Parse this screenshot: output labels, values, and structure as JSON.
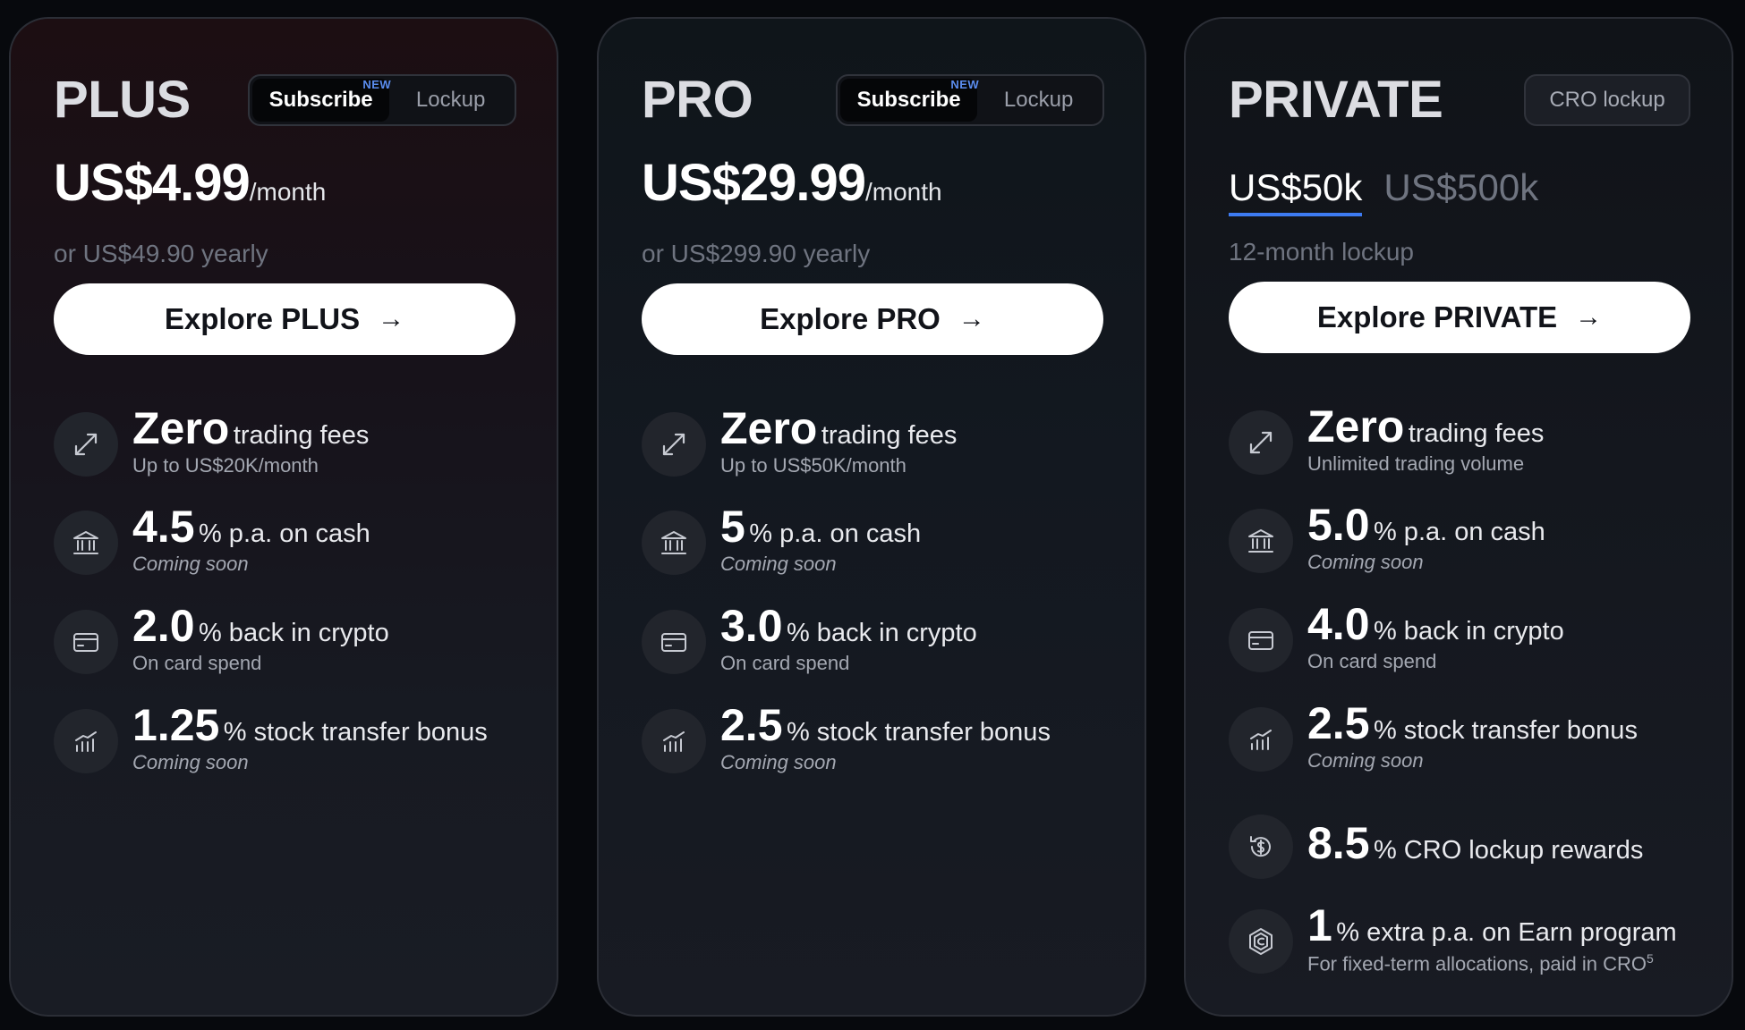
{
  "colors": {
    "accent_blue": "#3d7bf2",
    "new_tag": "#5b8def",
    "card_bg": "#15181f",
    "button_bg": "#ffffff"
  },
  "plans": [
    {
      "name": "PLUS",
      "toggle": {
        "subscribe": "Subscribe",
        "new": "NEW",
        "lockup": "Lockup"
      },
      "price": "US$4.99",
      "per": "/month",
      "yearly": "or US$49.90 yearly",
      "cta": "Explore PLUS",
      "features": [
        {
          "icon": "trade-arrows-icon",
          "big": "Zero",
          "desc": "trading fees",
          "sub": "Up to US$20K/month"
        },
        {
          "icon": "bank-icon",
          "big": "4.5",
          "desc": "% p.a. on cash",
          "sub": "Coming soon"
        },
        {
          "icon": "card-icon",
          "big": "2.0",
          "desc": "% back in crypto",
          "sub": "On card spend"
        },
        {
          "icon": "stock-chart-icon",
          "big": "1.25",
          "desc": "% stock transfer bonus",
          "sub": "Coming soon"
        }
      ]
    },
    {
      "name": "PRO",
      "toggle": {
        "subscribe": "Subscribe",
        "new": "NEW",
        "lockup": "Lockup"
      },
      "price": "US$29.99",
      "per": "/month",
      "yearly": "or US$299.90 yearly",
      "cta": "Explore PRO",
      "features": [
        {
          "icon": "trade-arrows-icon",
          "big": "Zero",
          "desc": "trading fees",
          "sub": "Up to US$50K/month"
        },
        {
          "icon": "bank-icon",
          "big": "5",
          "desc": "% p.a. on cash",
          "sub": "Coming soon"
        },
        {
          "icon": "card-icon",
          "big": "3.0",
          "desc": "% back in crypto",
          "sub": "On card spend"
        },
        {
          "icon": "stock-chart-icon",
          "big": "2.5",
          "desc": "% stock transfer bonus",
          "sub": "Coming soon"
        }
      ]
    },
    {
      "name": "PRIVATE",
      "lockup_label": "CRO lockup",
      "tabs": [
        "US$50k",
        "US$500k"
      ],
      "term": "12-month lockup",
      "cta": "Explore PRIVATE",
      "features": [
        {
          "icon": "trade-arrows-icon",
          "big": "Zero",
          "desc": "trading fees",
          "sub": "Unlimited trading volume"
        },
        {
          "icon": "bank-icon",
          "big": "5.0",
          "desc": "% p.a. on cash",
          "sub": "Coming soon"
        },
        {
          "icon": "card-icon",
          "big": "4.0",
          "desc": "% back in crypto",
          "sub": "On card spend"
        },
        {
          "icon": "stock-chart-icon",
          "big": "2.5",
          "desc": "% stock transfer bonus",
          "sub": "Coming soon"
        },
        {
          "icon": "cro-rewards-icon",
          "big": "8.5",
          "desc": "% CRO lockup rewards",
          "sub": ""
        },
        {
          "icon": "cro-token-icon",
          "big": "1",
          "desc": "% extra p.a. on Earn program",
          "sub": "For fixed-term allocations, paid in CRO",
          "footnote": "5"
        }
      ]
    }
  ]
}
